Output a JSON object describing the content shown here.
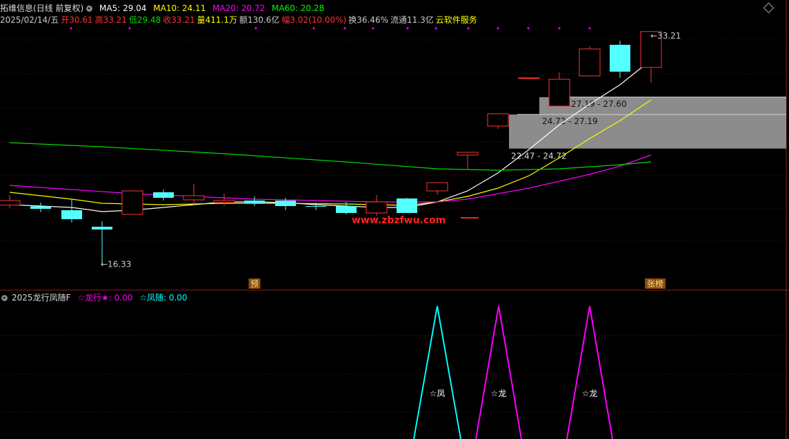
{
  "header": {
    "stock_name": "拓维信息",
    "period": "(日线 前复权)",
    "ma": [
      {
        "label": "MA5: 29.04",
        "color": "#ffffff"
      },
      {
        "label": "MA10: 24.11",
        "color": "#ffff00"
      },
      {
        "label": "MA20: 20.72",
        "color": "#ff00ff"
      },
      {
        "label": "MA60: 20.28",
        "color": "#00ff00"
      }
    ],
    "info": [
      {
        "text": "2025/02/14/五",
        "color": "#cccccc"
      },
      {
        "text": "开30.61",
        "color": "#ff3333"
      },
      {
        "text": "高33.21",
        "color": "#ff3333"
      },
      {
        "text": "低29.48",
        "color": "#00dd00"
      },
      {
        "text": "收33.21",
        "color": "#ff3333"
      },
      {
        "text": "量411.1万",
        "color": "#ffff00"
      },
      {
        "text": "额130.6亿",
        "color": "#cccccc"
      },
      {
        "text": "幅3.02(10.00%)",
        "color": "#ff3333"
      },
      {
        "text": "换36.46%",
        "color": "#cccccc"
      },
      {
        "text": "流通11.3亿",
        "color": "#cccccc"
      },
      {
        "text": "云软件服务",
        "color": "#ffff00"
      }
    ]
  },
  "indicator_header": {
    "name": "2025龙行凤随F",
    "items": [
      {
        "text": "☆龙行★: 0.00",
        "color": "#ff00ff"
      },
      {
        "text": "☆凤随: 0.00",
        "color": "#00ffff"
      }
    ]
  },
  "chart_data": [
    {
      "type": "candlestick",
      "title": "",
      "ylim": [
        15.0,
        34.5
      ],
      "candles": [
        {
          "x": 14,
          "open": 20.62,
          "close": 20.95,
          "high": 21.35,
          "low": 20.4
        },
        {
          "x": 59,
          "open": 20.53,
          "close": 20.35,
          "high": 20.8,
          "low": 20.1
        },
        {
          "x": 104,
          "open": 20.25,
          "close": 19.6,
          "high": 21.05,
          "low": 19.35
        },
        {
          "x": 148,
          "open": 19.05,
          "close": 18.85,
          "high": 19.45,
          "low": 16.33
        },
        {
          "x": 192,
          "open": 19.95,
          "close": 21.65,
          "high": 21.65,
          "low": 19.95
        },
        {
          "x": 237,
          "open": 21.55,
          "close": 21.15,
          "high": 21.75,
          "low": 20.95
        },
        {
          "x": 281,
          "open": 21.0,
          "close": 21.3,
          "high": 22.15,
          "low": 20.6
        },
        {
          "x": 325,
          "open": 20.8,
          "close": 20.95,
          "high": 21.45,
          "low": 20.55
        },
        {
          "x": 369,
          "open": 20.95,
          "close": 20.75,
          "high": 21.25,
          "low": 20.55
        },
        {
          "x": 414,
          "open": 20.95,
          "close": 20.55,
          "high": 21.15,
          "low": 20.25
        },
        {
          "x": 458,
          "open": 20.55,
          "close": 20.5,
          "high": 20.8,
          "low": 20.25
        },
        {
          "x": 502,
          "open": 20.55,
          "close": 20.05,
          "high": 20.85,
          "low": 19.95
        },
        {
          "x": 546,
          "open": 20.05,
          "close": 20.85,
          "high": 21.35,
          "low": 19.85
        },
        {
          "x": 590,
          "open": 21.1,
          "close": 20.05,
          "high": 21.15,
          "low": 20.05
        },
        {
          "x": 634,
          "open": 21.65,
          "close": 22.25,
          "high": 22.25,
          "low": 21.35
        },
        {
          "x": 678,
          "open": 24.25,
          "close": 24.45,
          "high": 24.45,
          "low": 23.25
        },
        {
          "x": 722,
          "open": 26.35,
          "close": 27.25,
          "high": 27.25,
          "low": 26.15
        },
        {
          "x": 767,
          "open": 29.85,
          "close": 29.85,
          "high": 29.85,
          "low": 29.8
        },
        {
          "x": 811,
          "open": 27.8,
          "close": 29.75,
          "high": 30.25,
          "low": 27.8
        },
        {
          "x": 855,
          "open": 30.0,
          "close": 31.95,
          "high": 32.15,
          "low": 29.95
        },
        {
          "x": 899,
          "open": 32.25,
          "close": 30.3,
          "high": 32.55,
          "low": 29.85
        },
        {
          "x": 944,
          "open": 30.61,
          "close": 33.21,
          "high": 33.21,
          "low": 29.48
        }
      ],
      "moving_averages": [
        {
          "label": "MA5",
          "color": "#ffffff",
          "points": [
            [
              14,
              20.65
            ],
            [
              104,
              20.45
            ],
            [
              148,
              20.15
            ],
            [
              192,
              20.25
            ],
            [
              237,
              20.45
            ],
            [
              281,
              20.65
            ],
            [
              325,
              20.85
            ],
            [
              369,
              20.85
            ],
            [
              414,
              20.8
            ],
            [
              458,
              20.65
            ],
            [
              502,
              20.55
            ],
            [
              546,
              20.45
            ],
            [
              590,
              20.45
            ],
            [
              634,
              20.85
            ],
            [
              678,
              21.65
            ],
            [
              722,
              22.95
            ],
            [
              767,
              24.65
            ],
            [
              811,
              26.45
            ],
            [
              855,
              27.95
            ],
            [
              899,
              29.35
            ],
            [
              944,
              31.15
            ]
          ]
        },
        {
          "label": "MA10",
          "color": "#ffff00",
          "points": [
            [
              14,
              21.55
            ],
            [
              104,
              21.05
            ],
            [
              148,
              20.75
            ],
            [
              237,
              20.65
            ],
            [
              325,
              20.75
            ],
            [
              414,
              20.75
            ],
            [
              502,
              20.7
            ],
            [
              590,
              20.6
            ],
            [
              634,
              20.85
            ],
            [
              678,
              21.25
            ],
            [
              722,
              21.85
            ],
            [
              767,
              22.75
            ],
            [
              811,
              24.05
            ],
            [
              855,
              25.45
            ],
            [
              899,
              26.75
            ],
            [
              944,
              28.25
            ]
          ]
        },
        {
          "label": "MA20",
          "color": "#ff00ff",
          "points": [
            [
              14,
              22.05
            ],
            [
              104,
              21.75
            ],
            [
              192,
              21.45
            ],
            [
              281,
              21.25
            ],
            [
              369,
              21.05
            ],
            [
              458,
              20.95
            ],
            [
              546,
              20.85
            ],
            [
              634,
              20.85
            ],
            [
              678,
              21.05
            ],
            [
              722,
              21.45
            ],
            [
              767,
              21.85
            ],
            [
              811,
              22.35
            ],
            [
              855,
              22.85
            ],
            [
              899,
              23.45
            ],
            [
              944,
              24.25
            ]
          ]
        },
        {
          "label": "MA60",
          "color": "#00dd00",
          "points": [
            [
              14,
              25.15
            ],
            [
              148,
              24.85
            ],
            [
              325,
              24.35
            ],
            [
              502,
              23.75
            ],
            [
              634,
              23.25
            ],
            [
              722,
              23.15
            ],
            [
              811,
              23.25
            ],
            [
              899,
              23.55
            ],
            [
              944,
              23.75
            ]
          ]
        }
      ],
      "zones": [
        {
          "label": "27.19 - 27.60",
          "x0": 782,
          "x1": 1140,
          "low": 27.19,
          "high": 28.45
        },
        {
          "label": "24.72 - 27.19",
          "x0": 738,
          "x1": 1140,
          "low": 24.72,
          "high": 27.19
        }
      ],
      "zone_label_extra": "22.47 - 24.72",
      "annotations": [
        {
          "text": "←16.33",
          "color": "#cccccc"
        },
        {
          "text": "←33.21",
          "color": "#cccccc"
        }
      ],
      "markers": [
        {
          "text": "预",
          "x": 369
        },
        {
          "text": "张榜",
          "x": 950
        }
      ],
      "watermark": "www.zbzfwu.com"
    },
    {
      "type": "line",
      "title": "",
      "ylim": [
        0,
        1
      ],
      "series": [
        {
          "color": "#00ffff",
          "points": [
            [
              600,
              0
            ],
            [
              634,
              1
            ],
            [
              668,
              0
            ]
          ],
          "label": "☆凤"
        },
        {
          "color": "#ff00ff",
          "points": [
            [
              690,
              0
            ],
            [
              723,
              1
            ],
            [
              756,
              0
            ]
          ],
          "label": "☆龙"
        },
        {
          "color": "#ff00ff",
          "points": [
            [
              822,
              0
            ],
            [
              855,
              1
            ],
            [
              888,
              0
            ]
          ],
          "label": "☆龙"
        }
      ]
    }
  ]
}
